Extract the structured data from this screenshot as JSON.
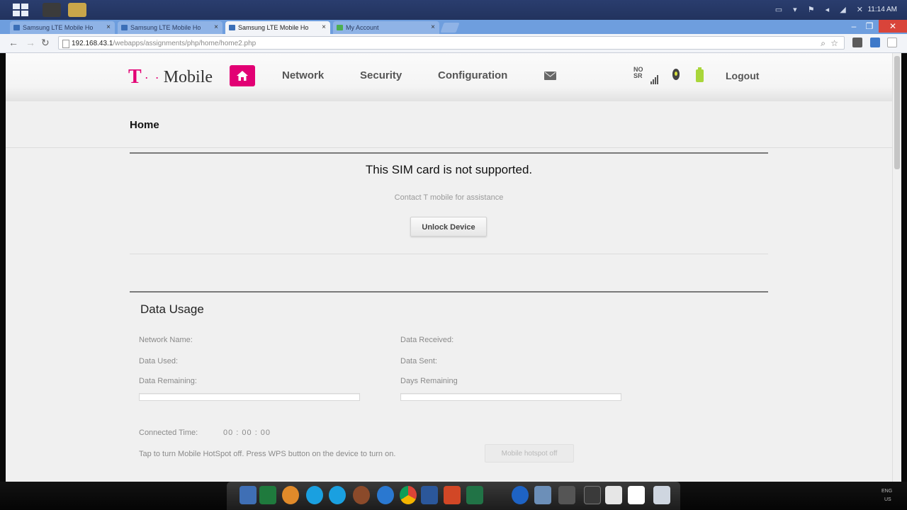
{
  "browser": {
    "tabs": [
      {
        "label": "Samsung LTE Mobile Ho",
        "active": false
      },
      {
        "label": "Samsung LTE Mobile Ho",
        "active": false
      },
      {
        "label": "Samsung LTE Mobile Ho",
        "active": true
      },
      {
        "label": "My Account",
        "active": false
      }
    ],
    "close_glyph": "×",
    "url_host": "192.168.43.1",
    "url_path": "/webapps/assignments/php/home/home2.php",
    "clock": "11:14 AM"
  },
  "header": {
    "logo_t": "T",
    "logo_dots": "· ·",
    "logo_rest": "Mobile",
    "nav": [
      "Network",
      "Security",
      "Configuration"
    ],
    "signal_text_top": "NO",
    "signal_text_bottom": "SR",
    "logout": "Logout"
  },
  "breadcrumb": "Home",
  "sim": {
    "title": "This SIM card is not supported.",
    "subtitle": "Contact T mobile for assistance",
    "button": "Unlock Device"
  },
  "data_usage": {
    "title": "Data Usage",
    "network_name": "Network Name:",
    "data_used": "Data Used:",
    "data_remaining": "Data Remaining:",
    "data_received": "Data Received:",
    "data_sent": "Data Sent:",
    "days_remaining": "Days Remaining",
    "data_remaining_fraction": 0,
    "days_remaining_fraction": 0,
    "connected_time_label": "Connected Time:",
    "connected_time_value": "00 : 00 : 00",
    "hotspot_note": "Tap to turn Mobile HotSpot off. Press WPS button on the device to turn on.",
    "hotspot_button": "Mobile hotspot off"
  },
  "taskbar": {
    "lang_top": "ENG",
    "lang_bottom": "US"
  },
  "colors": {
    "brand_magenta": "#e20074",
    "battery_green": "#a9d63a"
  }
}
